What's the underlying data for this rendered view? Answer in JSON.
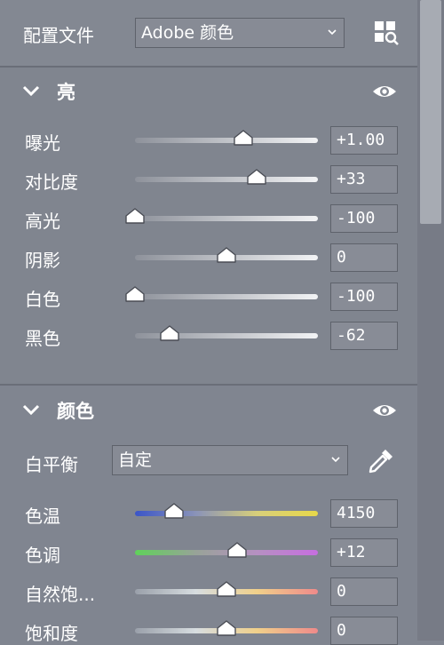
{
  "header": {
    "label": "配置文件",
    "profile": "Adobe 颜色"
  },
  "light": {
    "title": "亮",
    "sliders": [
      {
        "label": "曝光",
        "value": "+1.00",
        "pos": 0.59
      },
      {
        "label": "对比度",
        "value": "+33",
        "pos": 0.665
      },
      {
        "label": "高光",
        "value": "-100",
        "pos": 0.0
      },
      {
        "label": "阴影",
        "value": "0",
        "pos": 0.5
      },
      {
        "label": "白色",
        "value": "-100",
        "pos": 0.0
      },
      {
        "label": "黑色",
        "value": "-62",
        "pos": 0.19
      }
    ]
  },
  "color": {
    "title": "颜色",
    "wb_label": "白平衡",
    "wb_value": "自定",
    "sliders": [
      {
        "label": "色温",
        "value": "4150",
        "pos": 0.215
      },
      {
        "label": "色调",
        "value": "+12",
        "pos": 0.56
      },
      {
        "label": "自然饱...",
        "value": "0",
        "pos": 0.5
      },
      {
        "label": "饱和度",
        "value": "0",
        "pos": 0.5
      }
    ]
  },
  "colors": {
    "panel_bg": "#808590",
    "track_neutral": "#e6e7ea",
    "temp_start": "#3b55c8",
    "temp_end": "#e8d84a",
    "tint_start": "#5fd25a",
    "tint_end": "#c76ee0"
  }
}
